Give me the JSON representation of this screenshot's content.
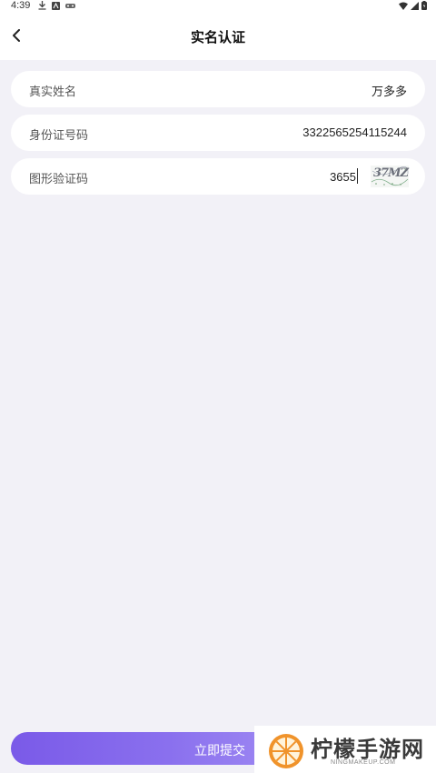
{
  "status_bar": {
    "time": "4:39",
    "left_icons": [
      "download-icon",
      "notification-a-icon",
      "notification-game-icon"
    ],
    "right_icons": [
      "wifi-icon",
      "signal-icon",
      "battery-icon"
    ]
  },
  "header": {
    "title": "实名认证",
    "back_icon": "chevron-left-icon"
  },
  "form": {
    "name_label": "真实姓名",
    "name_value": "万多多",
    "id_label": "身份证号码",
    "id_value": "3322565254115244",
    "captcha_label": "图形验证码",
    "captcha_value": "3655",
    "captcha_image_text": "37MZ"
  },
  "submit": {
    "label": "立即提交"
  },
  "watermark": {
    "text": "柠檬手游网",
    "subtext": "NINGMAKEUP.COM"
  },
  "colors": {
    "accent_start": "#7a5ae8",
    "accent_end": "#9c86f2",
    "background": "#f2f1f7",
    "card": "#ffffff"
  }
}
